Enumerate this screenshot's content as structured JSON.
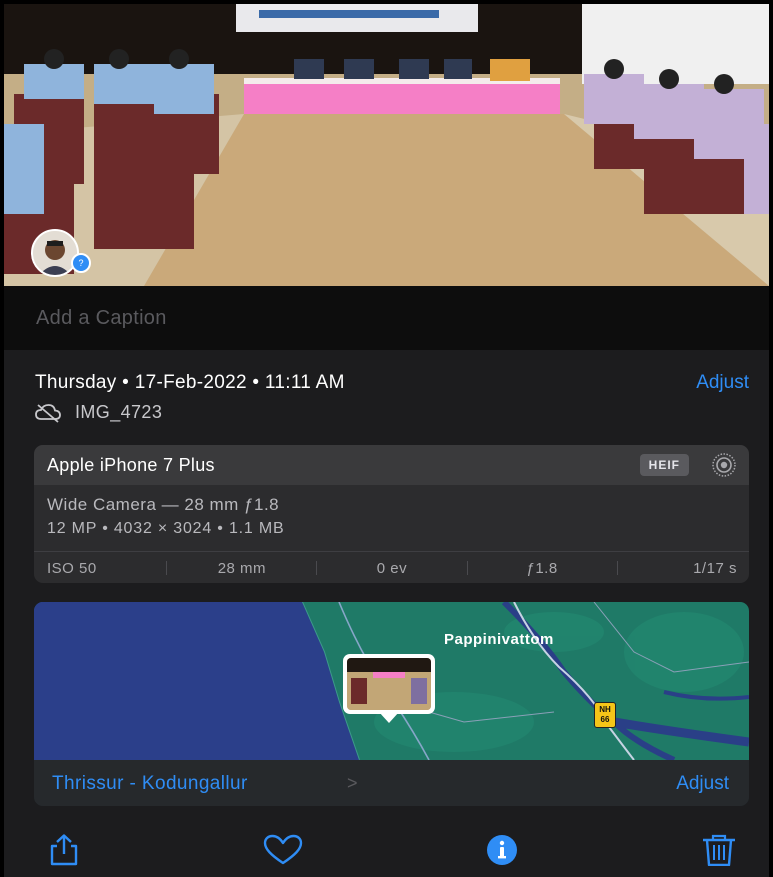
{
  "caption": {
    "placeholder": "Add a Caption"
  },
  "info": {
    "date": "Thursday • 17-Feb-2022 • 11:11 AM",
    "adjust_label": "Adjust",
    "filename": "IMG_4723",
    "cloud_icon": "cloud-slash-icon"
  },
  "camera": {
    "name": "Apple iPhone 7 Plus",
    "format_badge": "HEIF",
    "live_icon": "live-photo-icon",
    "lens": "Wide Camera — 28 mm ƒ1.8",
    "specs": "12 MP  •  4032 × 3024  •  1.1 MB",
    "exif": [
      "ISO 50",
      "28 mm",
      "0 ev",
      "ƒ1.8",
      "1/17 s"
    ]
  },
  "map": {
    "place": "Pappinivattom",
    "highway_badge": "NH 66",
    "region": "Thrissur - Kodungallur",
    "region_chevron": ">",
    "adjust_label": "Adjust"
  },
  "toolbar": {
    "icons": [
      "share-icon",
      "heart-icon",
      "info-icon",
      "trash-icon"
    ]
  },
  "colors": {
    "accent": "#2f8df5",
    "background": "#1c1c1e",
    "card": "#2c2c2e",
    "water": "#2a3f87",
    "land": "#1f7a67"
  }
}
